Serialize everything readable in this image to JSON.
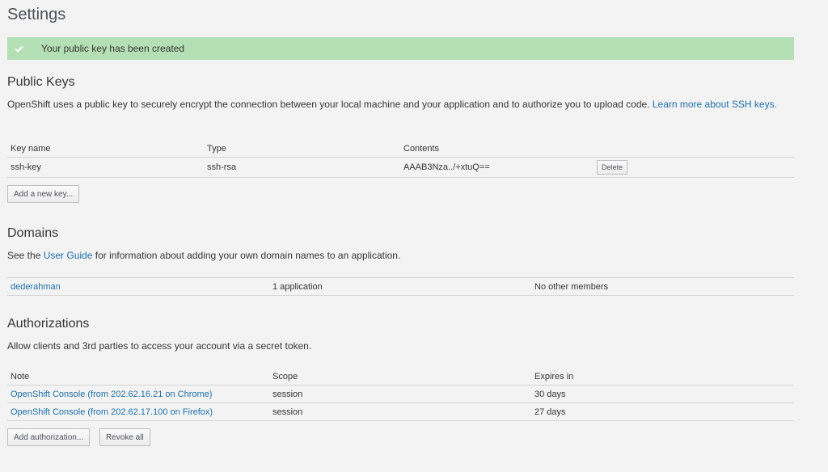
{
  "page": {
    "title": "Settings"
  },
  "alert": {
    "message": "Your public key has been created",
    "icon": "check-icon"
  },
  "public_keys": {
    "heading": "Public Keys",
    "description": "OpenShift uses a public key to securely encrypt the connection between your local machine and your application and to authorize you to upload code. ",
    "learn_more_link": "Learn more about SSH keys.",
    "columns": [
      "Key name",
      "Type",
      "Contents"
    ],
    "rows": [
      {
        "name": "ssh-key",
        "type": "ssh-rsa",
        "contents": "AAAB3Nza../+xtuQ==",
        "delete_label": "Delete"
      }
    ],
    "add_button": "Add a new key..."
  },
  "domains": {
    "heading": "Domains",
    "description_prefix": "See the ",
    "user_guide_link": "User Guide",
    "description_suffix": " for information about adding your own domain names to an application.",
    "rows": [
      {
        "name": "dederahman",
        "applications": "1 application",
        "members": "No other members"
      }
    ]
  },
  "authorizations": {
    "heading": "Authorizations",
    "description": "Allow clients and 3rd parties to access your account via a secret token.",
    "columns": [
      "Note",
      "Scope",
      "Expires in"
    ],
    "rows": [
      {
        "note": "OpenShift Console (from 202.62.16.21 on Chrome)",
        "scope": "session",
        "expires": "30 days"
      },
      {
        "note": "OpenShift Console (from 202.62.17.100 on Firefox)",
        "scope": "session",
        "expires": "27 days"
      }
    ],
    "add_button": "Add authorization...",
    "revoke_button": "Revoke all"
  },
  "colors": {
    "background": "#f3f3f3",
    "alert_bg": "#b5dfb4",
    "link": "#1d6fa8",
    "text": "#363636"
  }
}
